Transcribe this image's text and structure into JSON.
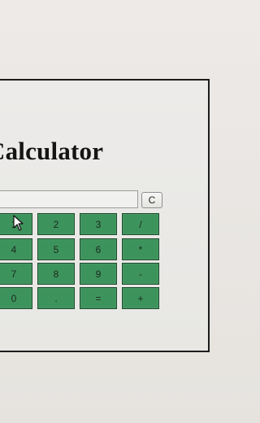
{
  "app": {
    "title": "Calculator"
  },
  "display": {
    "value": ""
  },
  "clear_button": {
    "label": "C"
  },
  "keypad": {
    "rows": [
      [
        "1",
        "2",
        "3",
        "/"
      ],
      [
        "4",
        "5",
        "6",
        "*"
      ],
      [
        "7",
        "8",
        "9",
        "-"
      ],
      [
        "0",
        ".",
        "=",
        "+"
      ]
    ]
  },
  "colors": {
    "key_green": "#3d935c",
    "frame_border": "#1c1c1c",
    "background": "#ebe8e5"
  },
  "icons": {
    "cursor": "mouse-pointer-icon"
  }
}
